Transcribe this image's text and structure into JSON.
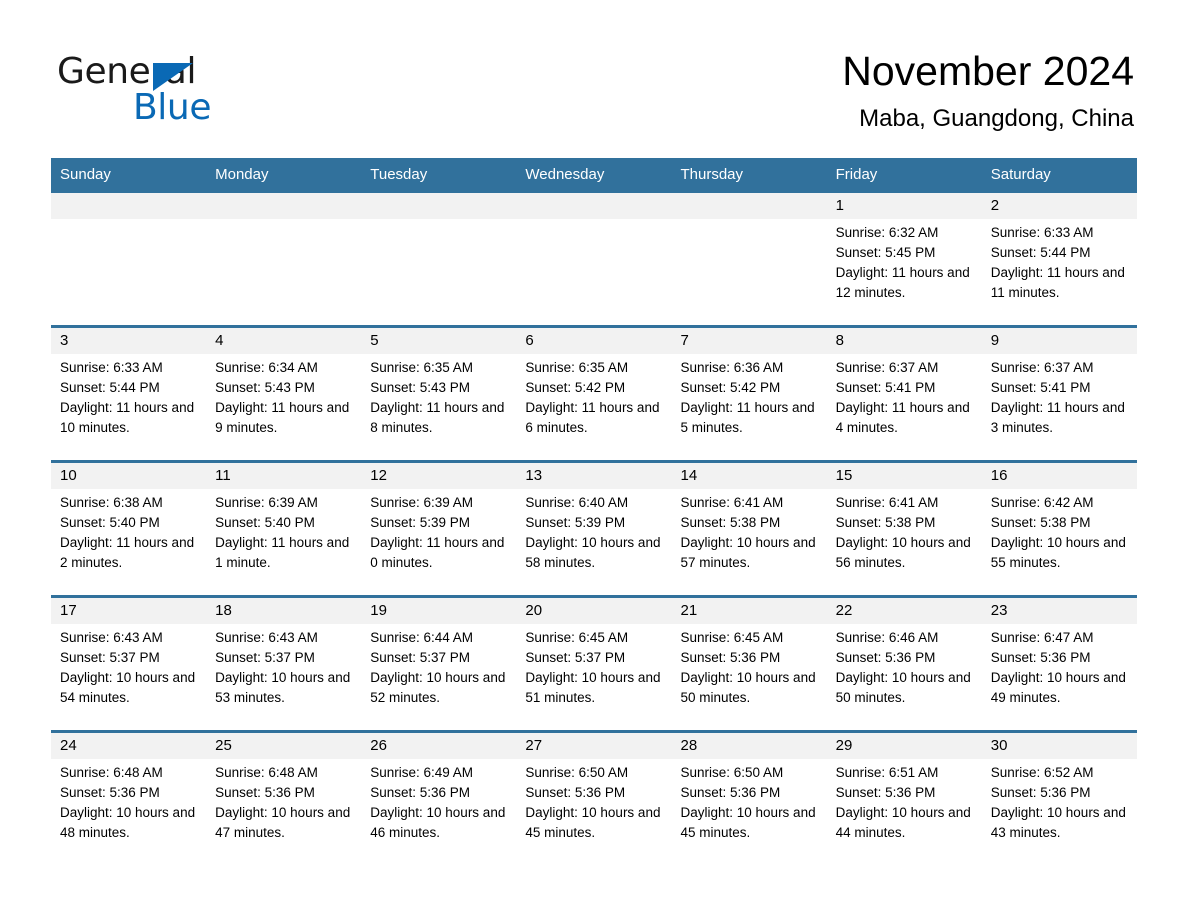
{
  "brand": {
    "name_part1": "General",
    "name_part2": "Blue",
    "logo_icon": "triangle-flag-icon",
    "accent_color": "#0a69b5"
  },
  "header": {
    "month_title": "November 2024",
    "location": "Maba, Guangdong, China"
  },
  "theme": {
    "header_blue": "#31719c",
    "daynum_band": "#f2f2f2",
    "text": "#000000"
  },
  "weekday_headers": [
    "Sunday",
    "Monday",
    "Tuesday",
    "Wednesday",
    "Thursday",
    "Friday",
    "Saturday"
  ],
  "weeks": [
    [
      {
        "day": "",
        "sunrise": "",
        "sunset": "",
        "daylight": "",
        "empty": true
      },
      {
        "day": "",
        "sunrise": "",
        "sunset": "",
        "daylight": "",
        "empty": true
      },
      {
        "day": "",
        "sunrise": "",
        "sunset": "",
        "daylight": "",
        "empty": true
      },
      {
        "day": "",
        "sunrise": "",
        "sunset": "",
        "daylight": "",
        "empty": true
      },
      {
        "day": "",
        "sunrise": "",
        "sunset": "",
        "daylight": "",
        "empty": true
      },
      {
        "day": "1",
        "sunrise": "Sunrise: 6:32 AM",
        "sunset": "Sunset: 5:45 PM",
        "daylight": "Daylight: 11 hours and 12 minutes.",
        "empty": false
      },
      {
        "day": "2",
        "sunrise": "Sunrise: 6:33 AM",
        "sunset": "Sunset: 5:44 PM",
        "daylight": "Daylight: 11 hours and 11 minutes.",
        "empty": false
      }
    ],
    [
      {
        "day": "3",
        "sunrise": "Sunrise: 6:33 AM",
        "sunset": "Sunset: 5:44 PM",
        "daylight": "Daylight: 11 hours and 10 minutes.",
        "empty": false
      },
      {
        "day": "4",
        "sunrise": "Sunrise: 6:34 AM",
        "sunset": "Sunset: 5:43 PM",
        "daylight": "Daylight: 11 hours and 9 minutes.",
        "empty": false
      },
      {
        "day": "5",
        "sunrise": "Sunrise: 6:35 AM",
        "sunset": "Sunset: 5:43 PM",
        "daylight": "Daylight: 11 hours and 8 minutes.",
        "empty": false
      },
      {
        "day": "6",
        "sunrise": "Sunrise: 6:35 AM",
        "sunset": "Sunset: 5:42 PM",
        "daylight": "Daylight: 11 hours and 6 minutes.",
        "empty": false
      },
      {
        "day": "7",
        "sunrise": "Sunrise: 6:36 AM",
        "sunset": "Sunset: 5:42 PM",
        "daylight": "Daylight: 11 hours and 5 minutes.",
        "empty": false
      },
      {
        "day": "8",
        "sunrise": "Sunrise: 6:37 AM",
        "sunset": "Sunset: 5:41 PM",
        "daylight": "Daylight: 11 hours and 4 minutes.",
        "empty": false
      },
      {
        "day": "9",
        "sunrise": "Sunrise: 6:37 AM",
        "sunset": "Sunset: 5:41 PM",
        "daylight": "Daylight: 11 hours and 3 minutes.",
        "empty": false
      }
    ],
    [
      {
        "day": "10",
        "sunrise": "Sunrise: 6:38 AM",
        "sunset": "Sunset: 5:40 PM",
        "daylight": "Daylight: 11 hours and 2 minutes.",
        "empty": false
      },
      {
        "day": "11",
        "sunrise": "Sunrise: 6:39 AM",
        "sunset": "Sunset: 5:40 PM",
        "daylight": "Daylight: 11 hours and 1 minute.",
        "empty": false
      },
      {
        "day": "12",
        "sunrise": "Sunrise: 6:39 AM",
        "sunset": "Sunset: 5:39 PM",
        "daylight": "Daylight: 11 hours and 0 minutes.",
        "empty": false
      },
      {
        "day": "13",
        "sunrise": "Sunrise: 6:40 AM",
        "sunset": "Sunset: 5:39 PM",
        "daylight": "Daylight: 10 hours and 58 minutes.",
        "empty": false
      },
      {
        "day": "14",
        "sunrise": "Sunrise: 6:41 AM",
        "sunset": "Sunset: 5:38 PM",
        "daylight": "Daylight: 10 hours and 57 minutes.",
        "empty": false
      },
      {
        "day": "15",
        "sunrise": "Sunrise: 6:41 AM",
        "sunset": "Sunset: 5:38 PM",
        "daylight": "Daylight: 10 hours and 56 minutes.",
        "empty": false
      },
      {
        "day": "16",
        "sunrise": "Sunrise: 6:42 AM",
        "sunset": "Sunset: 5:38 PM",
        "daylight": "Daylight: 10 hours and 55 minutes.",
        "empty": false
      }
    ],
    [
      {
        "day": "17",
        "sunrise": "Sunrise: 6:43 AM",
        "sunset": "Sunset: 5:37 PM",
        "daylight": "Daylight: 10 hours and 54 minutes.",
        "empty": false
      },
      {
        "day": "18",
        "sunrise": "Sunrise: 6:43 AM",
        "sunset": "Sunset: 5:37 PM",
        "daylight": "Daylight: 10 hours and 53 minutes.",
        "empty": false
      },
      {
        "day": "19",
        "sunrise": "Sunrise: 6:44 AM",
        "sunset": "Sunset: 5:37 PM",
        "daylight": "Daylight: 10 hours and 52 minutes.",
        "empty": false
      },
      {
        "day": "20",
        "sunrise": "Sunrise: 6:45 AM",
        "sunset": "Sunset: 5:37 PM",
        "daylight": "Daylight: 10 hours and 51 minutes.",
        "empty": false
      },
      {
        "day": "21",
        "sunrise": "Sunrise: 6:45 AM",
        "sunset": "Sunset: 5:36 PM",
        "daylight": "Daylight: 10 hours and 50 minutes.",
        "empty": false
      },
      {
        "day": "22",
        "sunrise": "Sunrise: 6:46 AM",
        "sunset": "Sunset: 5:36 PM",
        "daylight": "Daylight: 10 hours and 50 minutes.",
        "empty": false
      },
      {
        "day": "23",
        "sunrise": "Sunrise: 6:47 AM",
        "sunset": "Sunset: 5:36 PM",
        "daylight": "Daylight: 10 hours and 49 minutes.",
        "empty": false
      }
    ],
    [
      {
        "day": "24",
        "sunrise": "Sunrise: 6:48 AM",
        "sunset": "Sunset: 5:36 PM",
        "daylight": "Daylight: 10 hours and 48 minutes.",
        "empty": false
      },
      {
        "day": "25",
        "sunrise": "Sunrise: 6:48 AM",
        "sunset": "Sunset: 5:36 PM",
        "daylight": "Daylight: 10 hours and 47 minutes.",
        "empty": false
      },
      {
        "day": "26",
        "sunrise": "Sunrise: 6:49 AM",
        "sunset": "Sunset: 5:36 PM",
        "daylight": "Daylight: 10 hours and 46 minutes.",
        "empty": false
      },
      {
        "day": "27",
        "sunrise": "Sunrise: 6:50 AM",
        "sunset": "Sunset: 5:36 PM",
        "daylight": "Daylight: 10 hours and 45 minutes.",
        "empty": false
      },
      {
        "day": "28",
        "sunrise": "Sunrise: 6:50 AM",
        "sunset": "Sunset: 5:36 PM",
        "daylight": "Daylight: 10 hours and 45 minutes.",
        "empty": false
      },
      {
        "day": "29",
        "sunrise": "Sunrise: 6:51 AM",
        "sunset": "Sunset: 5:36 PM",
        "daylight": "Daylight: 10 hours and 44 minutes.",
        "empty": false
      },
      {
        "day": "30",
        "sunrise": "Sunrise: 6:52 AM",
        "sunset": "Sunset: 5:36 PM",
        "daylight": "Daylight: 10 hours and 43 minutes.",
        "empty": false
      }
    ]
  ]
}
